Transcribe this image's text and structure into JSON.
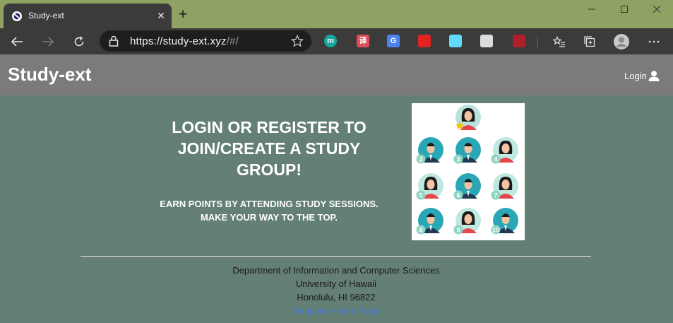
{
  "browser": {
    "tab_title": "Study-ext",
    "tab_close": "✕",
    "new_tab": "+",
    "url_host": "https://study-ext.xyz",
    "url_path": "/#/",
    "extensions": [
      {
        "name": "mendeley-ext-icon",
        "color": "#16a7a0",
        "letter": "m"
      },
      {
        "name": "translate-red-ext-icon",
        "color": "#e04b5a",
        "letter": "译"
      },
      {
        "name": "google-translate-ext-icon",
        "color": "#4a82ee",
        "letter": "G"
      },
      {
        "name": "shield-ext-icon",
        "color": "#e02424",
        "letter": ""
      },
      {
        "name": "react-devtools-ext-icon",
        "color": "#61dafb",
        "letter": ""
      },
      {
        "name": "tampermonkey-ext-icon",
        "color": "#dcdcdc",
        "letter": ""
      },
      {
        "name": "ruler-ext-icon",
        "color": "#b01f2a",
        "letter": ""
      }
    ]
  },
  "navbar": {
    "brand": "Study-ext",
    "login_label": "Login"
  },
  "main": {
    "headline": "LOGIN OR REGISTER TO JOIN/CREATE A STUDY GROUP!",
    "subline_1": "EARN POINTS BY ATTENDING STUDY SESSIONS.",
    "subline_2": "MAKE YOUR WAY TO THE TOP.",
    "illustration": {
      "name": "ranked-people-avatars",
      "ranks": [
        "",
        "2",
        "3",
        "4",
        "5",
        "6",
        "7",
        "8",
        "9",
        "10"
      ]
    }
  },
  "footer": {
    "line_1": "Department of Information and Computer Sciences",
    "line_2": "University of Hawaii",
    "line_3": "Honolulu, HI 96822",
    "link": "Template Home Page"
  }
}
